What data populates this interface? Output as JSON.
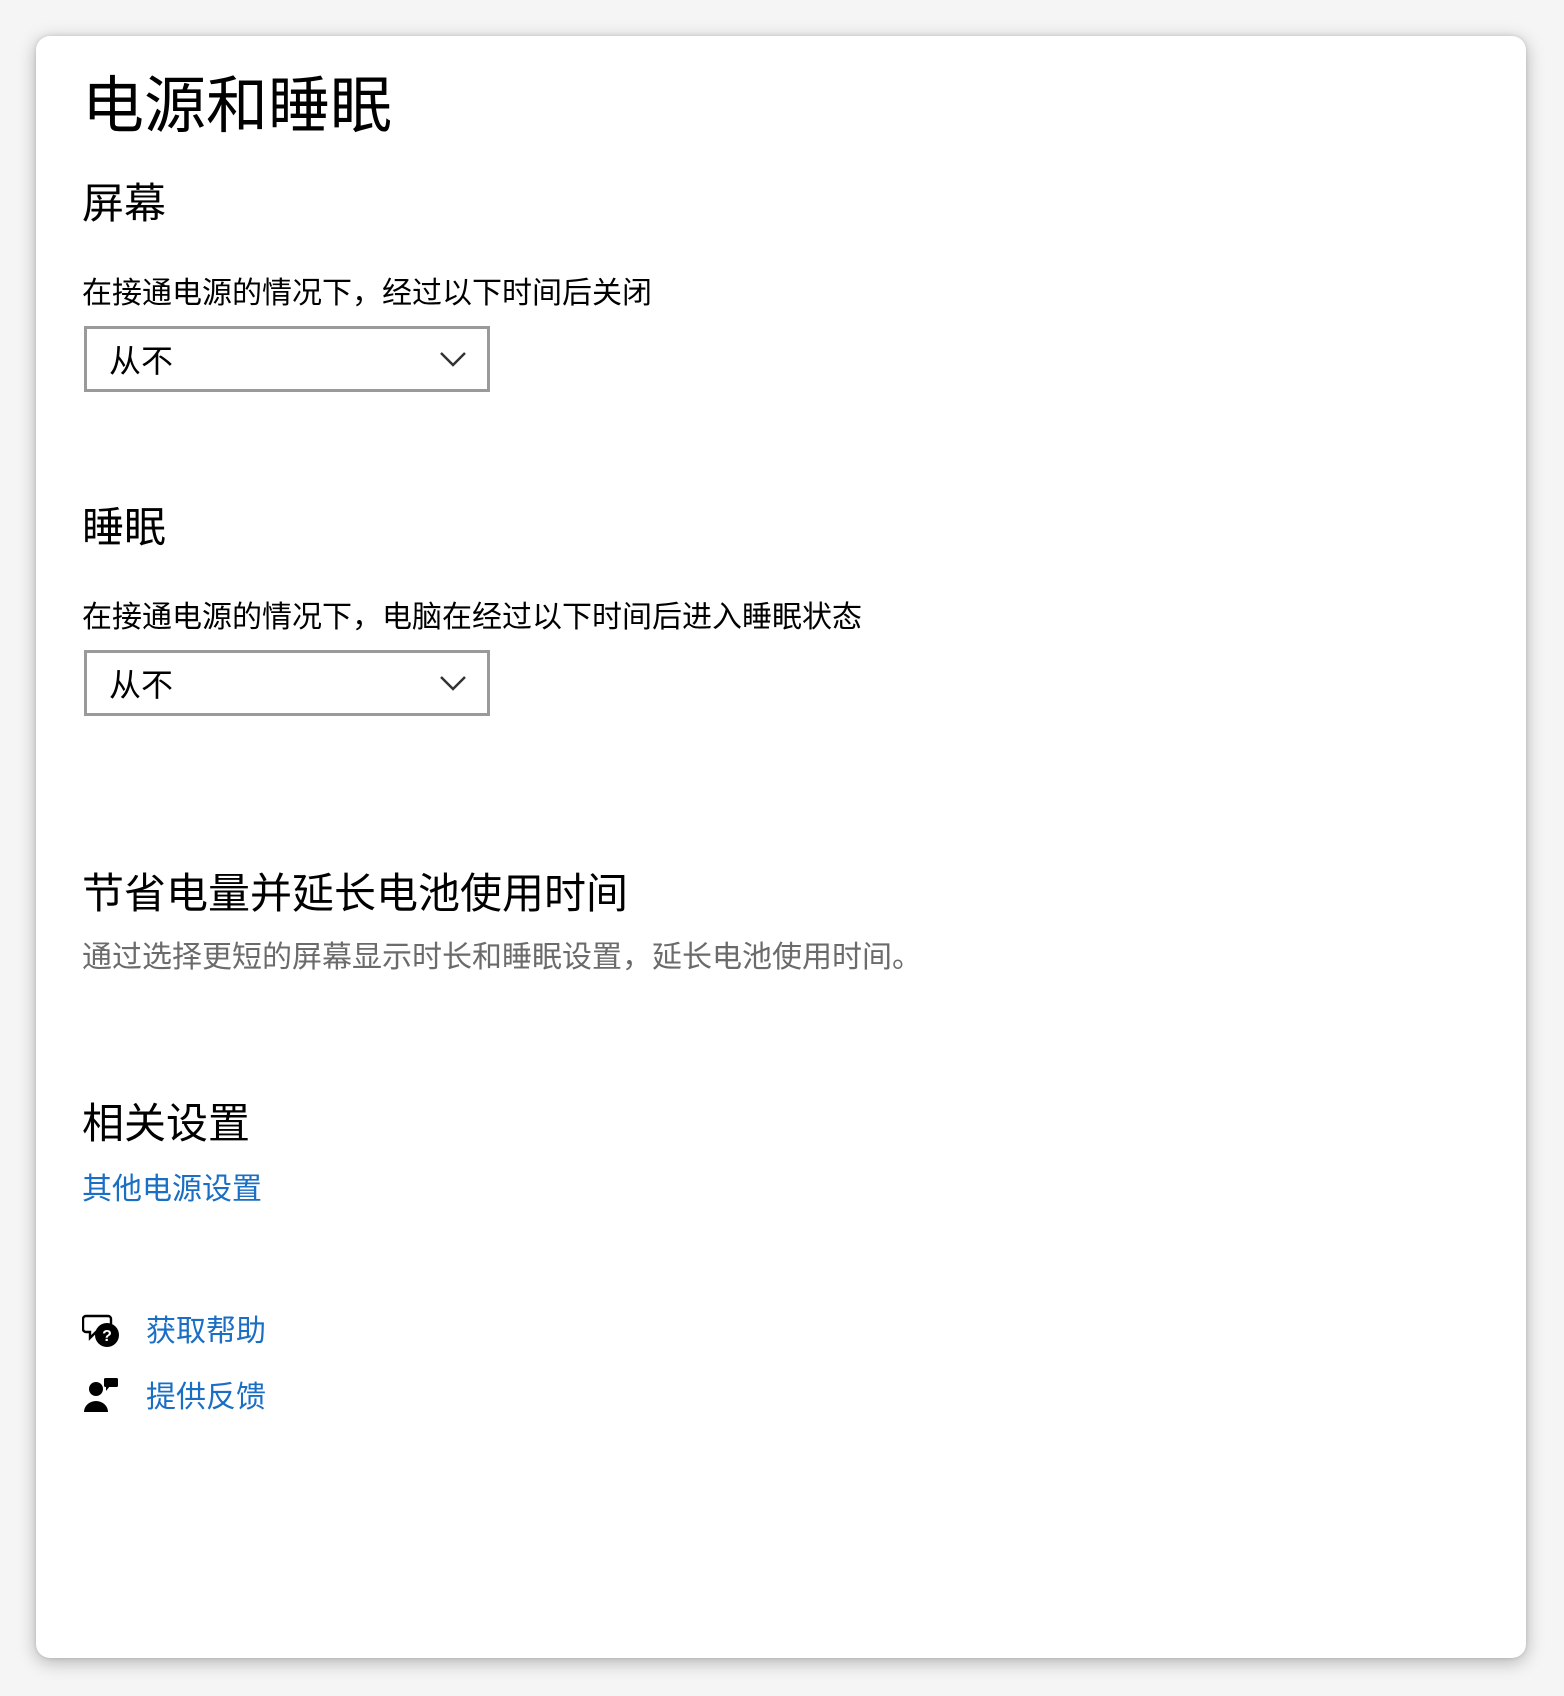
{
  "page": {
    "title": "电源和睡眠"
  },
  "screen": {
    "heading": "屏幕",
    "label": "在接通电源的情况下，经过以下时间后关闭",
    "dropdown_value": "从不"
  },
  "sleep": {
    "heading": "睡眠",
    "label": "在接通电源的情况下，电脑在经过以下时间后进入睡眠状态",
    "dropdown_value": "从不"
  },
  "battery": {
    "heading": "节省电量并延长电池使用时间",
    "description": "通过选择更短的屏幕显示时长和睡眠设置，延长电池使用时间。"
  },
  "related": {
    "heading": "相关设置",
    "link": "其他电源设置"
  },
  "help": {
    "get_help": "获取帮助",
    "feedback": "提供反馈",
    "get_help_icon": "chat-help-icon",
    "feedback_icon": "feedback-person-icon"
  },
  "colors": {
    "link": "#1a6fc4",
    "muted_text": "#6b6b6b",
    "dropdown_border": "#9a9a9a"
  }
}
